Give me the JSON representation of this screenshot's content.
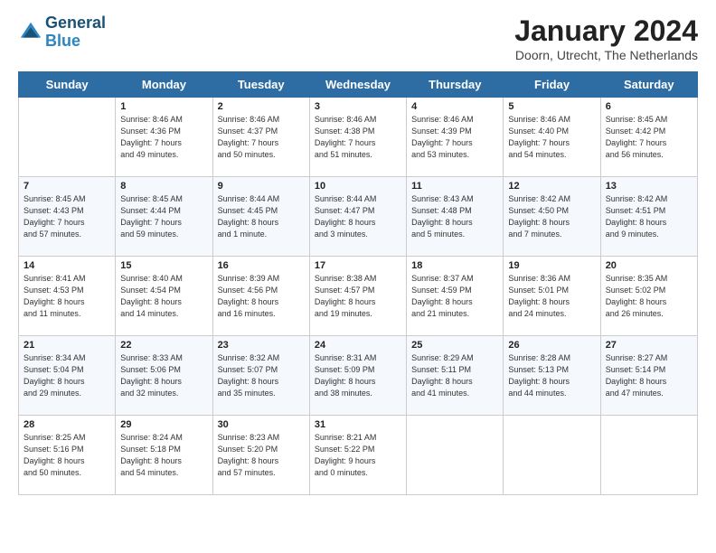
{
  "header": {
    "logo_line1": "General",
    "logo_line2": "Blue",
    "title": "January 2024",
    "subtitle": "Doorn, Utrecht, The Netherlands"
  },
  "weekdays": [
    "Sunday",
    "Monday",
    "Tuesday",
    "Wednesday",
    "Thursday",
    "Friday",
    "Saturday"
  ],
  "weeks": [
    [
      {
        "day": "",
        "info": ""
      },
      {
        "day": "1",
        "info": "Sunrise: 8:46 AM\nSunset: 4:36 PM\nDaylight: 7 hours\nand 49 minutes."
      },
      {
        "day": "2",
        "info": "Sunrise: 8:46 AM\nSunset: 4:37 PM\nDaylight: 7 hours\nand 50 minutes."
      },
      {
        "day": "3",
        "info": "Sunrise: 8:46 AM\nSunset: 4:38 PM\nDaylight: 7 hours\nand 51 minutes."
      },
      {
        "day": "4",
        "info": "Sunrise: 8:46 AM\nSunset: 4:39 PM\nDaylight: 7 hours\nand 53 minutes."
      },
      {
        "day": "5",
        "info": "Sunrise: 8:46 AM\nSunset: 4:40 PM\nDaylight: 7 hours\nand 54 minutes."
      },
      {
        "day": "6",
        "info": "Sunrise: 8:45 AM\nSunset: 4:42 PM\nDaylight: 7 hours\nand 56 minutes."
      }
    ],
    [
      {
        "day": "7",
        "info": "Sunrise: 8:45 AM\nSunset: 4:43 PM\nDaylight: 7 hours\nand 57 minutes."
      },
      {
        "day": "8",
        "info": "Sunrise: 8:45 AM\nSunset: 4:44 PM\nDaylight: 7 hours\nand 59 minutes."
      },
      {
        "day": "9",
        "info": "Sunrise: 8:44 AM\nSunset: 4:45 PM\nDaylight: 8 hours\nand 1 minute."
      },
      {
        "day": "10",
        "info": "Sunrise: 8:44 AM\nSunset: 4:47 PM\nDaylight: 8 hours\nand 3 minutes."
      },
      {
        "day": "11",
        "info": "Sunrise: 8:43 AM\nSunset: 4:48 PM\nDaylight: 8 hours\nand 5 minutes."
      },
      {
        "day": "12",
        "info": "Sunrise: 8:42 AM\nSunset: 4:50 PM\nDaylight: 8 hours\nand 7 minutes."
      },
      {
        "day": "13",
        "info": "Sunrise: 8:42 AM\nSunset: 4:51 PM\nDaylight: 8 hours\nand 9 minutes."
      }
    ],
    [
      {
        "day": "14",
        "info": "Sunrise: 8:41 AM\nSunset: 4:53 PM\nDaylight: 8 hours\nand 11 minutes."
      },
      {
        "day": "15",
        "info": "Sunrise: 8:40 AM\nSunset: 4:54 PM\nDaylight: 8 hours\nand 14 minutes."
      },
      {
        "day": "16",
        "info": "Sunrise: 8:39 AM\nSunset: 4:56 PM\nDaylight: 8 hours\nand 16 minutes."
      },
      {
        "day": "17",
        "info": "Sunrise: 8:38 AM\nSunset: 4:57 PM\nDaylight: 8 hours\nand 19 minutes."
      },
      {
        "day": "18",
        "info": "Sunrise: 8:37 AM\nSunset: 4:59 PM\nDaylight: 8 hours\nand 21 minutes."
      },
      {
        "day": "19",
        "info": "Sunrise: 8:36 AM\nSunset: 5:01 PM\nDaylight: 8 hours\nand 24 minutes."
      },
      {
        "day": "20",
        "info": "Sunrise: 8:35 AM\nSunset: 5:02 PM\nDaylight: 8 hours\nand 26 minutes."
      }
    ],
    [
      {
        "day": "21",
        "info": "Sunrise: 8:34 AM\nSunset: 5:04 PM\nDaylight: 8 hours\nand 29 minutes."
      },
      {
        "day": "22",
        "info": "Sunrise: 8:33 AM\nSunset: 5:06 PM\nDaylight: 8 hours\nand 32 minutes."
      },
      {
        "day": "23",
        "info": "Sunrise: 8:32 AM\nSunset: 5:07 PM\nDaylight: 8 hours\nand 35 minutes."
      },
      {
        "day": "24",
        "info": "Sunrise: 8:31 AM\nSunset: 5:09 PM\nDaylight: 8 hours\nand 38 minutes."
      },
      {
        "day": "25",
        "info": "Sunrise: 8:29 AM\nSunset: 5:11 PM\nDaylight: 8 hours\nand 41 minutes."
      },
      {
        "day": "26",
        "info": "Sunrise: 8:28 AM\nSunset: 5:13 PM\nDaylight: 8 hours\nand 44 minutes."
      },
      {
        "day": "27",
        "info": "Sunrise: 8:27 AM\nSunset: 5:14 PM\nDaylight: 8 hours\nand 47 minutes."
      }
    ],
    [
      {
        "day": "28",
        "info": "Sunrise: 8:25 AM\nSunset: 5:16 PM\nDaylight: 8 hours\nand 50 minutes."
      },
      {
        "day": "29",
        "info": "Sunrise: 8:24 AM\nSunset: 5:18 PM\nDaylight: 8 hours\nand 54 minutes."
      },
      {
        "day": "30",
        "info": "Sunrise: 8:23 AM\nSunset: 5:20 PM\nDaylight: 8 hours\nand 57 minutes."
      },
      {
        "day": "31",
        "info": "Sunrise: 8:21 AM\nSunset: 5:22 PM\nDaylight: 9 hours\nand 0 minutes."
      },
      {
        "day": "",
        "info": ""
      },
      {
        "day": "",
        "info": ""
      },
      {
        "day": "",
        "info": ""
      }
    ]
  ]
}
